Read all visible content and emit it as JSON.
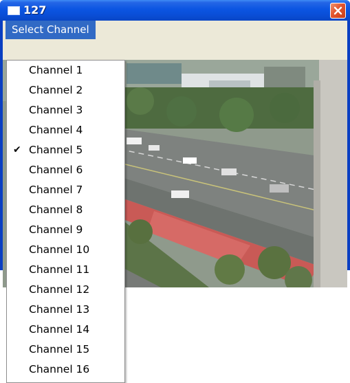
{
  "window": {
    "title": "127"
  },
  "menubar": {
    "select_channel_label": "Select Channel"
  },
  "channels": [
    {
      "label": "Channel 1",
      "checked": false
    },
    {
      "label": "Channel 2",
      "checked": false
    },
    {
      "label": "Channel 3",
      "checked": false
    },
    {
      "label": "Channel 4",
      "checked": false
    },
    {
      "label": "Channel 5",
      "checked": true
    },
    {
      "label": "Channel 6",
      "checked": false
    },
    {
      "label": "Channel 7",
      "checked": false
    },
    {
      "label": "Channel 8",
      "checked": false
    },
    {
      "label": "Channel 9",
      "checked": false
    },
    {
      "label": "Channel 10",
      "checked": false
    },
    {
      "label": "Channel 11",
      "checked": false
    },
    {
      "label": "Channel 12",
      "checked": false
    },
    {
      "label": "Channel 13",
      "checked": false
    },
    {
      "label": "Channel 14",
      "checked": false
    },
    {
      "label": "Channel 15",
      "checked": false
    },
    {
      "label": "Channel 16",
      "checked": false
    }
  ],
  "icons": {
    "window_icon": "window-icon",
    "close": "close-icon",
    "checkmark": "checkmark-icon"
  },
  "colors": {
    "titlebar": "#0b55e2",
    "menu_highlight": "#316ac5",
    "close_button": "#e2552f"
  }
}
